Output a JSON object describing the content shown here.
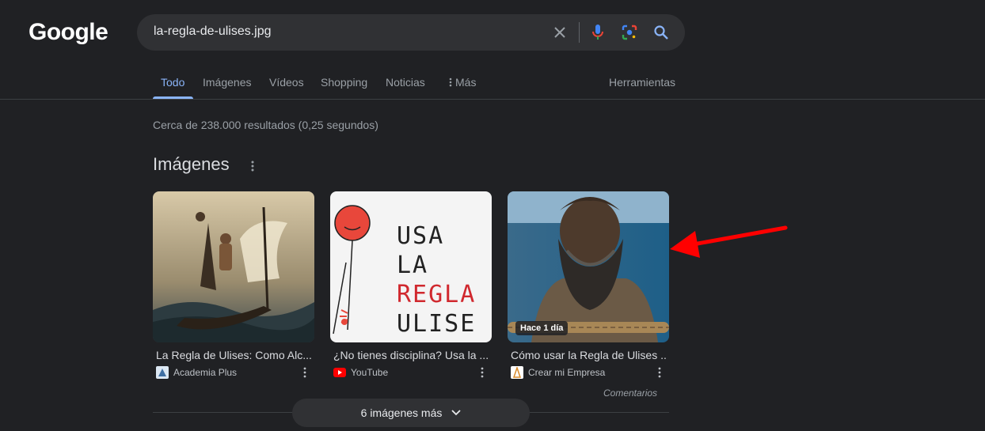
{
  "header": {
    "logo_text": "Google",
    "search": {
      "value": "la-regla-de-ulises.jpg"
    },
    "icons": [
      "close-icon",
      "microphone-icon",
      "lens-icon",
      "search-icon"
    ]
  },
  "tabs": [
    {
      "label": "Todo",
      "active": true
    },
    {
      "label": "Imágenes"
    },
    {
      "label": "Vídeos"
    },
    {
      "label": "Shopping"
    },
    {
      "label": "Noticias"
    },
    {
      "label": "Más"
    }
  ],
  "tools_label": "Herramientas",
  "result_stats": "Cerca de 238.000 resultados (0,25 segundos)",
  "images_section": {
    "title": "Imágenes",
    "cards": [
      {
        "title": "La Regla de Ulises: Como Alc...",
        "source": "Academia Plus"
      },
      {
        "title": "¿No tienes disciplina? Usa la ...",
        "source": "YouTube",
        "thumb_text": [
          "USA LA",
          "REGLA",
          "ULISE"
        ]
      },
      {
        "title": "Cómo usar la Regla de Ulises ...",
        "source": "Crear mi Empresa",
        "badge": "Hace 1 día"
      }
    ],
    "feedback_label": "Comentarios",
    "more_button_label": "6 imágenes más"
  },
  "colors": {
    "accent": "#8ab4f8",
    "background": "#202124",
    "arrow": "#ff0000"
  }
}
